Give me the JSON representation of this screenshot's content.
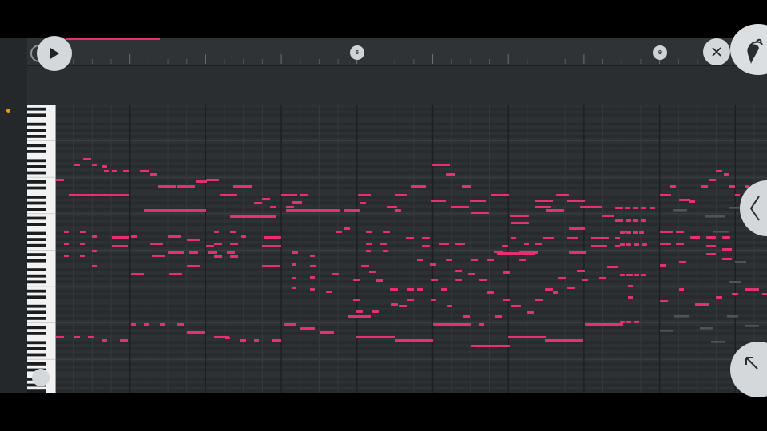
{
  "ruler": {
    "bar_markers": [
      {
        "label": "5",
        "bar": 5
      },
      {
        "label": "9",
        "bar": 9
      }
    ],
    "playback_progress_percent": 13
  },
  "icons": {
    "play": "play-icon",
    "close": "close-icon",
    "logo": "fruit-logo-icon",
    "side_arrow": "chevron-left-icon",
    "corner": "arrow-up-left-icon"
  },
  "colors": {
    "note": "#e7306f",
    "grid_background": "#2a2e31",
    "button": "#d5d8db",
    "indicator": "#e8a200"
  },
  "piano_roll": {
    "note_rows_per_octave": 12,
    "horizontal_scroll_percent": 28
  }
}
